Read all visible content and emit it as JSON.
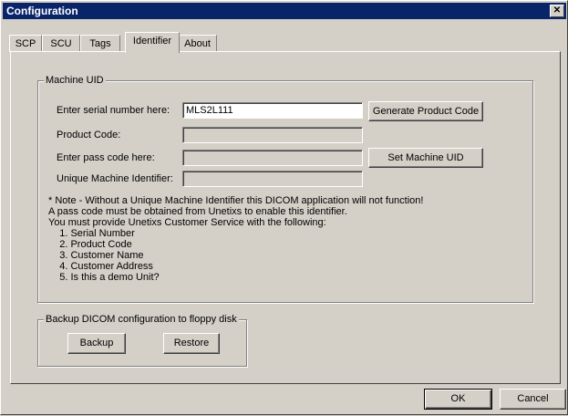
{
  "window": {
    "title": "Configuration",
    "close_glyph": "✕"
  },
  "tabs": [
    {
      "label": "SCP"
    },
    {
      "label": "SCU"
    },
    {
      "label": "Tags"
    },
    {
      "label": "Identifier",
      "active": true
    },
    {
      "label": "About"
    }
  ],
  "machine_uid": {
    "group_label": "Machine UID",
    "serial_label": "Enter serial number here:",
    "serial_value": "MLS2L111",
    "product_code_label": "Product Code:",
    "product_code_value": "",
    "pass_code_label": "Enter pass code here:",
    "pass_code_value": "",
    "unique_id_label": "Unique Machine Identifier:",
    "unique_id_value": "",
    "generate_button": "Generate Product Code",
    "set_button": "Set Machine UID",
    "note_lines": [
      "* Note - Without a Unique Machine Identifier this DICOM application will not function!",
      "A pass code must be obtained from Unetixs to enable this identifier.",
      "You must provide Unetixs Customer Service with the following:",
      "    1. Serial Number",
      "    2. Product Code",
      "    3. Customer Name",
      "    4. Customer Address",
      "    5. Is this a demo Unit?"
    ]
  },
  "backup": {
    "group_label": "Backup DICOM configuration to floppy disk",
    "backup_button": "Backup",
    "restore_button": "Restore"
  },
  "footer": {
    "ok_button": "OK",
    "cancel_button": "Cancel"
  }
}
